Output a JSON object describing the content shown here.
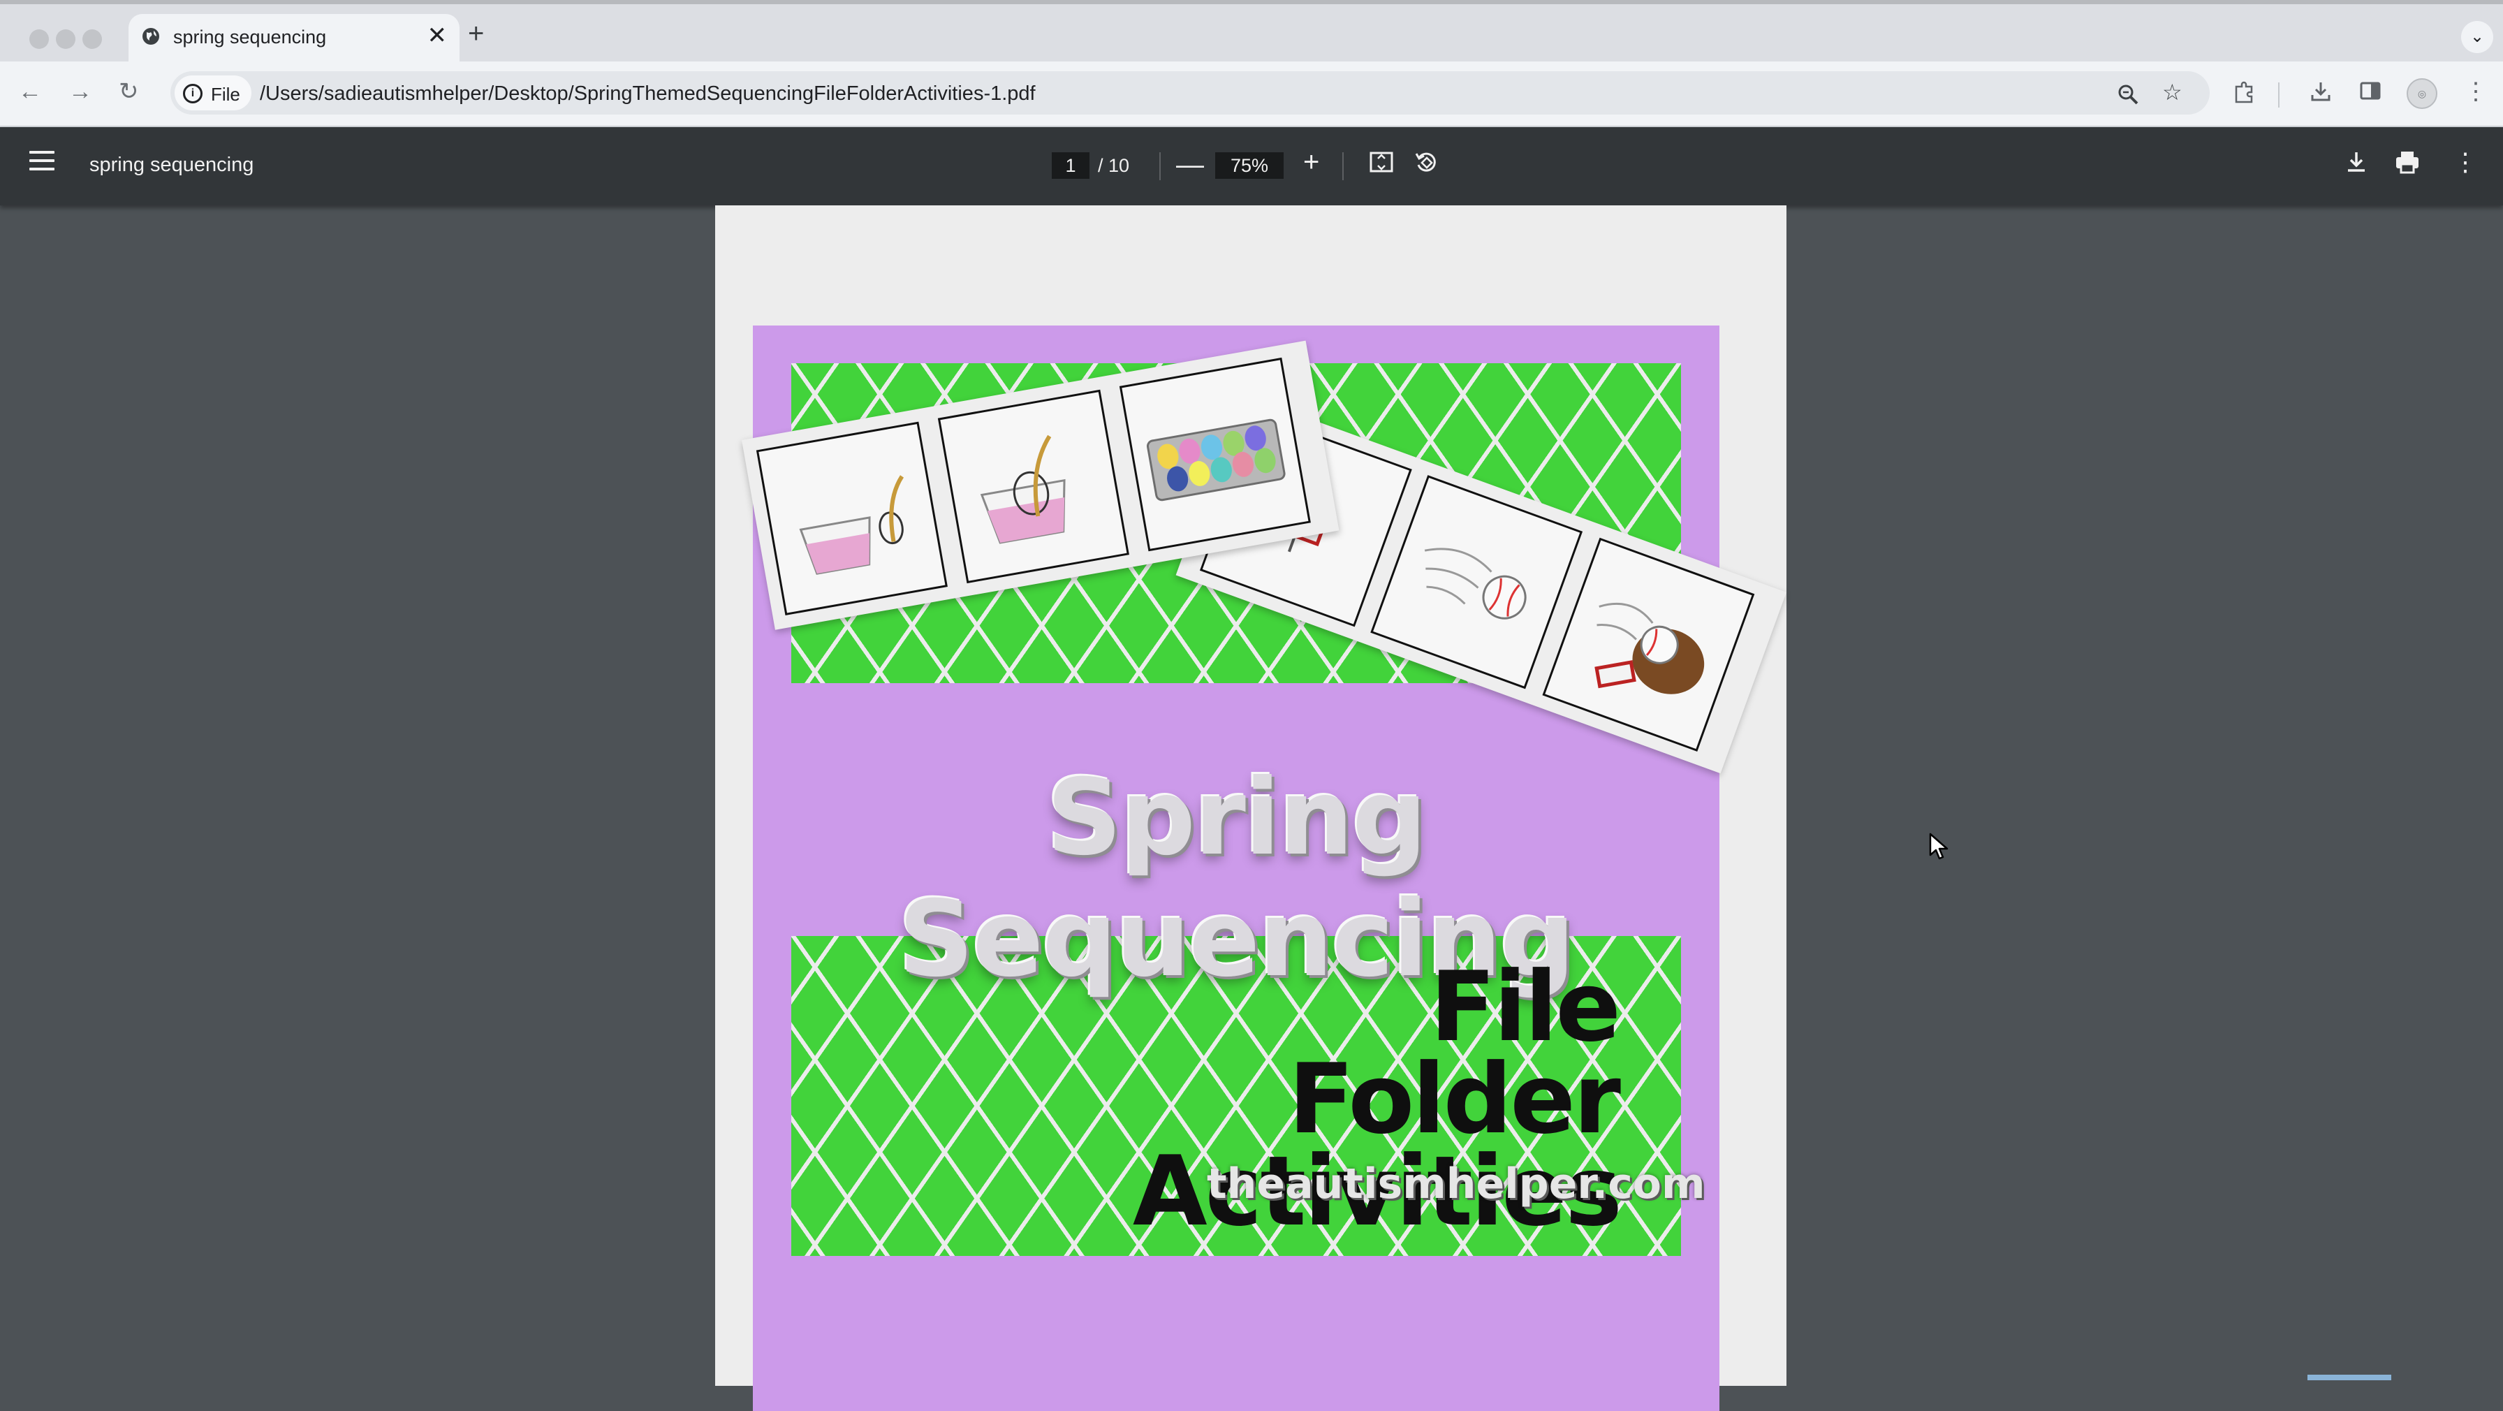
{
  "browser": {
    "tab": {
      "title": "spring sequencing",
      "close_glyph": "✕"
    },
    "new_tab_glyph": "+",
    "address": {
      "chip_label": "File",
      "url": "/Users/sadieautismhelper/Desktop/SpringThemedSequencingFileFolderActivities-1.pdf"
    },
    "icons": [
      "back-arrow-icon",
      "forward-arrow-icon",
      "reload-icon",
      "zoom-icon",
      "bookmark-star-icon",
      "extensions-icon",
      "download-icon",
      "side-panel-icon",
      "profile-avatar-icon",
      "more-menu-icon"
    ]
  },
  "pdf_toolbar": {
    "title": "spring sequencing",
    "current_page": "1",
    "total_pages": "/ 10",
    "zoom": "75%",
    "zoom_out_glyph": "—",
    "zoom_in_glyph": "+"
  },
  "document": {
    "title": "Spring Sequencing",
    "subtitle_line1": "File Folder",
    "subtitle_line2": "Activities",
    "website": "theautismhelper.com",
    "colors": {
      "border": "#cc9aea",
      "argyle_green": "#42d33b",
      "argyle_line": "#ececec"
    }
  }
}
